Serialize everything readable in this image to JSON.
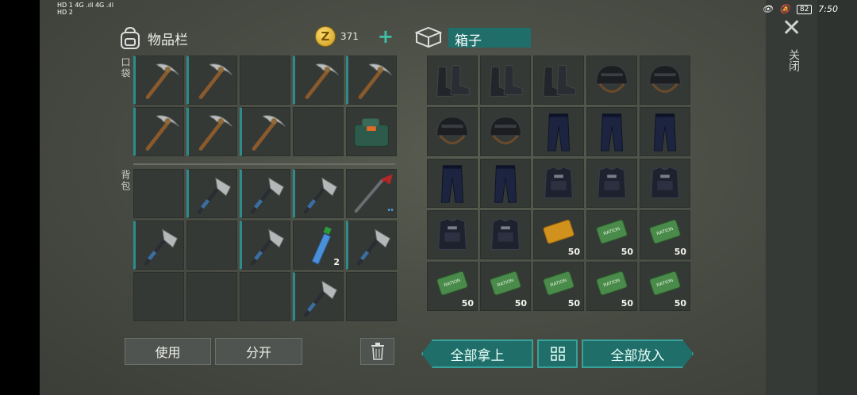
{
  "status_bar": {
    "left_line1": "HD 1  4G .ıll 4G .ıll",
    "left_line2": "HD 2",
    "battery": "82",
    "time": "7:50"
  },
  "inventory": {
    "title": "物品栏",
    "coins": "371",
    "pocket_label": "口袋",
    "backpack_label": "背包",
    "pocket_slots": [
      {
        "item": "pickaxe",
        "marked": true
      },
      {
        "item": "pickaxe",
        "marked": true
      },
      {
        "item": "",
        "marked": false
      },
      {
        "item": "pickaxe",
        "marked": true
      },
      {
        "item": "pickaxe",
        "marked": true
      },
      {
        "item": "pickaxe",
        "marked": true
      },
      {
        "item": "pickaxe",
        "marked": true
      },
      {
        "item": "pickaxe",
        "marked": true
      },
      {
        "item": "",
        "marked": false
      },
      {
        "item": "medkit",
        "marked": false
      }
    ],
    "backpack_slots": [
      {
        "item": "",
        "marked": false
      },
      {
        "item": "hatchet",
        "marked": true
      },
      {
        "item": "hatchet",
        "marked": true
      },
      {
        "item": "hatchet",
        "marked": true
      },
      {
        "item": "crowbar",
        "marked": false,
        "dots": "••"
      },
      {
        "item": "hatchet",
        "marked": true
      },
      {
        "item": "",
        "marked": false
      },
      {
        "item": "hatchet",
        "marked": true
      },
      {
        "item": "bottle",
        "marked": false,
        "qty": "2"
      },
      {
        "item": "hatchet",
        "marked": true
      },
      {
        "item": "",
        "marked": false
      },
      {
        "item": "",
        "marked": false
      },
      {
        "item": "",
        "marked": false
      },
      {
        "item": "hatchet",
        "marked": true
      },
      {
        "item": "",
        "marked": false
      }
    ],
    "use_button": "使用",
    "split_button": "分开"
  },
  "box": {
    "title": "箱子",
    "slots": [
      {
        "item": "boots"
      },
      {
        "item": "boots"
      },
      {
        "item": "boots"
      },
      {
        "item": "helmet"
      },
      {
        "item": "helmet"
      },
      {
        "item": "helmet"
      },
      {
        "item": "helmet"
      },
      {
        "item": "pants"
      },
      {
        "item": "pants"
      },
      {
        "item": "pants"
      },
      {
        "item": "pants"
      },
      {
        "item": "pants"
      },
      {
        "item": "vest"
      },
      {
        "item": "vest"
      },
      {
        "item": "vest"
      },
      {
        "item": "vest"
      },
      {
        "item": "vest"
      },
      {
        "item": "coupon-gold",
        "qty": "50"
      },
      {
        "item": "coupon-green",
        "qty": "50"
      },
      {
        "item": "coupon-green",
        "qty": "50"
      },
      {
        "item": "coupon-green",
        "qty": "50"
      },
      {
        "item": "coupon-green",
        "qty": "50"
      },
      {
        "item": "coupon-green",
        "qty": "50"
      },
      {
        "item": "coupon-green",
        "qty": "50"
      },
      {
        "item": "coupon-green",
        "qty": "50"
      }
    ],
    "take_all_button": "全部拿上",
    "put_all_button": "全部放入"
  },
  "close_label": "关闭",
  "colors": {
    "accent_teal": "#1f6e6a",
    "slot_marker": "#2e8b8b"
  }
}
